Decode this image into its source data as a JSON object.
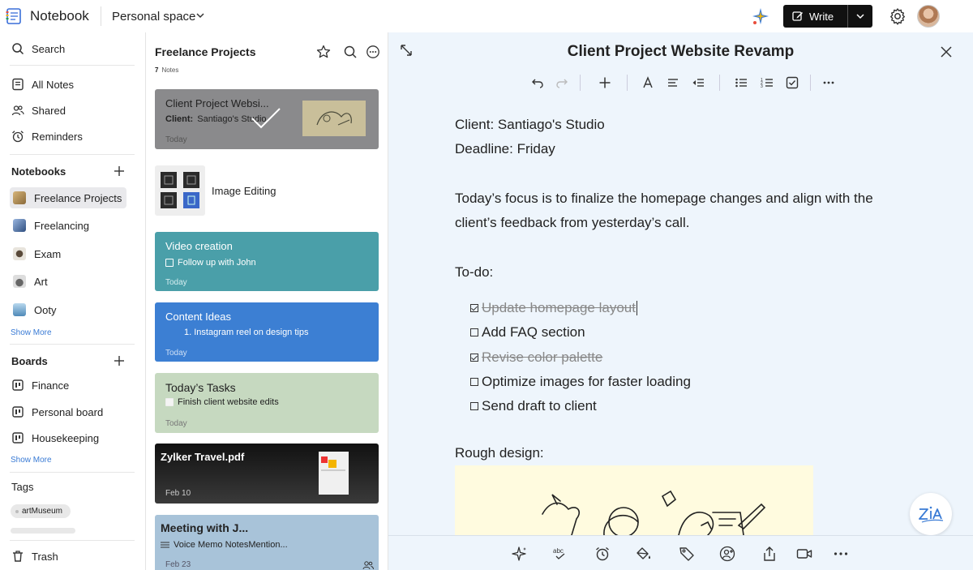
{
  "app": {
    "name": "Notebook",
    "space": "Personal space"
  },
  "topbar": {
    "write_label": "Write"
  },
  "sidebar": {
    "search": "Search",
    "nav": [
      {
        "label": "All Notes",
        "icon": "notes-icon"
      },
      {
        "label": "Shared",
        "icon": "users-icon"
      },
      {
        "label": "Reminders",
        "icon": "alarm-icon"
      }
    ],
    "notebooks_heading": "Notebooks",
    "notebooks": [
      {
        "label": "Freelance Projects",
        "color": "#c9a36b"
      },
      {
        "label": "Freelancing",
        "color": "#5a7bb0"
      },
      {
        "label": "Exam",
        "color": "#7a6a5a"
      },
      {
        "label": "Art",
        "color": "#8a8a8a"
      },
      {
        "label": "Ooty",
        "color": "#6aa3c9"
      }
    ],
    "show_more": "Show More",
    "boards_heading": "Boards",
    "boards": [
      {
        "label": "Finance"
      },
      {
        "label": "Personal board"
      },
      {
        "label": "Housekeeping"
      }
    ],
    "boards_show_more": "Show More",
    "tags_heading": "Tags",
    "tags": [
      "artMuseum"
    ],
    "trash": "Trash"
  },
  "notes_list": {
    "title": "Freelance Projects",
    "count": "7",
    "count_label": "Notes",
    "cards": [
      {
        "title": "Client Project Websi...",
        "sub_bold": "Client:",
        "sub": "Santiago's Studio",
        "date": "Today",
        "bg": "#8a8a8c"
      },
      {
        "title": "Image Editing"
      },
      {
        "title": "Video creation",
        "sub": "Follow up with John",
        "date": "Today",
        "bg": "#4a9fa9"
      },
      {
        "title": "Content Ideas",
        "sub": "1. Instagram reel on design tips",
        "date": "Today",
        "bg": "#3c7fd3"
      },
      {
        "title": "Today’s Tasks",
        "sub": "Finish client website edits",
        "date": "Today",
        "bg": "#c6d9c0"
      },
      {
        "title": "Zylker Travel.pdf",
        "date": "Feb 10",
        "bg": "#2a2a2a"
      },
      {
        "title": "Meeting with J...",
        "sub": "Voice Memo NotesMention...",
        "date": "Feb 23",
        "bg": "#a8c3d9"
      }
    ]
  },
  "editor": {
    "title": "Client Project Website Revamp",
    "client_label": "Client:",
    "client_value": "Santiago's Studio",
    "deadline_label": "Deadline:",
    "deadline_value": "Friday",
    "para_line1": "Today’s focus is to finalize the homepage changes and align with the",
    "para_line2": "client’s feedback from yesterday’s call.",
    "todo_heading": "To-do:",
    "todos": [
      {
        "text": "Update homepage layout",
        "done": true
      },
      {
        "text": "Add FAQ section",
        "done": false
      },
      {
        "text": "Revise color palette",
        "done": true
      },
      {
        "text": "Optimize images for faster loading",
        "done": false
      },
      {
        "text": "Send draft to client",
        "done": false
      }
    ],
    "rough_heading": "Rough design:"
  }
}
